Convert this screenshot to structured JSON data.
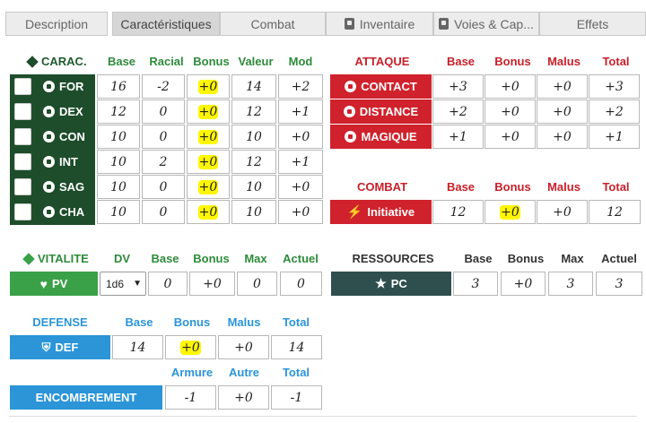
{
  "tabs": [
    {
      "label": "Description"
    },
    {
      "label": "Caractéristiques",
      "active": true
    },
    {
      "label": "Combat"
    },
    {
      "label": "Inventaire",
      "icon": "book-icon"
    },
    {
      "label": "Voies & Cap...",
      "icon": "book-icon"
    },
    {
      "label": "Effets"
    }
  ],
  "carac": {
    "title": "CARAC.",
    "columns": [
      "Base",
      "Racial",
      "Bonus",
      "Valeur",
      "Mod"
    ],
    "rows": [
      {
        "name": "FOR",
        "base": "16",
        "racial": "-2",
        "bonus": "+0",
        "valeur": "14",
        "mod": "+2"
      },
      {
        "name": "DEX",
        "base": "12",
        "racial": "0",
        "bonus": "+0",
        "valeur": "12",
        "mod": "+1"
      },
      {
        "name": "CON",
        "base": "10",
        "racial": "0",
        "bonus": "+0",
        "valeur": "10",
        "mod": "+0"
      },
      {
        "name": "INT",
        "base": "10",
        "racial": "2",
        "bonus": "+0",
        "valeur": "12",
        "mod": "+1"
      },
      {
        "name": "SAG",
        "base": "10",
        "racial": "0",
        "bonus": "+0",
        "valeur": "10",
        "mod": "+0"
      },
      {
        "name": "CHA",
        "base": "10",
        "racial": "0",
        "bonus": "+0",
        "valeur": "10",
        "mod": "+0"
      }
    ]
  },
  "attaque": {
    "title": "ATTAQUE",
    "columns": [
      "Base",
      "Bonus",
      "Malus",
      "Total"
    ],
    "rows": [
      {
        "name": "CONTACT",
        "base": "+3",
        "bonus": "+0",
        "malus": "+0",
        "total": "+3"
      },
      {
        "name": "DISTANCE",
        "base": "+2",
        "bonus": "+0",
        "malus": "+0",
        "total": "+2"
      },
      {
        "name": "MAGIQUE",
        "base": "+1",
        "bonus": "+0",
        "malus": "+0",
        "total": "+1"
      }
    ]
  },
  "combat": {
    "title": "COMBAT",
    "columns": [
      "Base",
      "Bonus",
      "Malus",
      "Total"
    ],
    "initiative": {
      "name": "Initiative",
      "base": "12",
      "bonus": "+0",
      "malus": "+0",
      "total": "12"
    }
  },
  "vitalite": {
    "title": "VITALITE",
    "columns": [
      "DV",
      "Base",
      "Bonus",
      "Max",
      "Actuel"
    ],
    "pv": {
      "name": "PV",
      "dv": "1d6",
      "base": "0",
      "bonus": "+0",
      "max": "0",
      "actuel": "0"
    }
  },
  "ressources": {
    "title": "RESSOURCES",
    "columns": [
      "Base",
      "Bonus",
      "Max",
      "Actuel"
    ],
    "pc": {
      "name": "PC",
      "base": "3",
      "bonus": "+0",
      "max": "3",
      "actuel": "3"
    }
  },
  "defense": {
    "title": "DEFENSE",
    "columns": [
      "Base",
      "Bonus",
      "Malus",
      "Total"
    ],
    "def": {
      "name": "DEF",
      "base": "14",
      "bonus": "+0",
      "malus": "+0",
      "total": "14"
    }
  },
  "encombrement": {
    "columns": [
      "Armure",
      "Autre",
      "Total"
    ],
    "name": "ENCOMBREMENT",
    "armure": "-1",
    "autre": "+0",
    "total": "-1"
  },
  "colors": {
    "carac": "#1e4d2b",
    "attaque": "#d0222c",
    "vitalite": "#3aa149",
    "defense": "#2b95d8",
    "ressources": "#2f4f4f",
    "highlight": "#fff600"
  }
}
